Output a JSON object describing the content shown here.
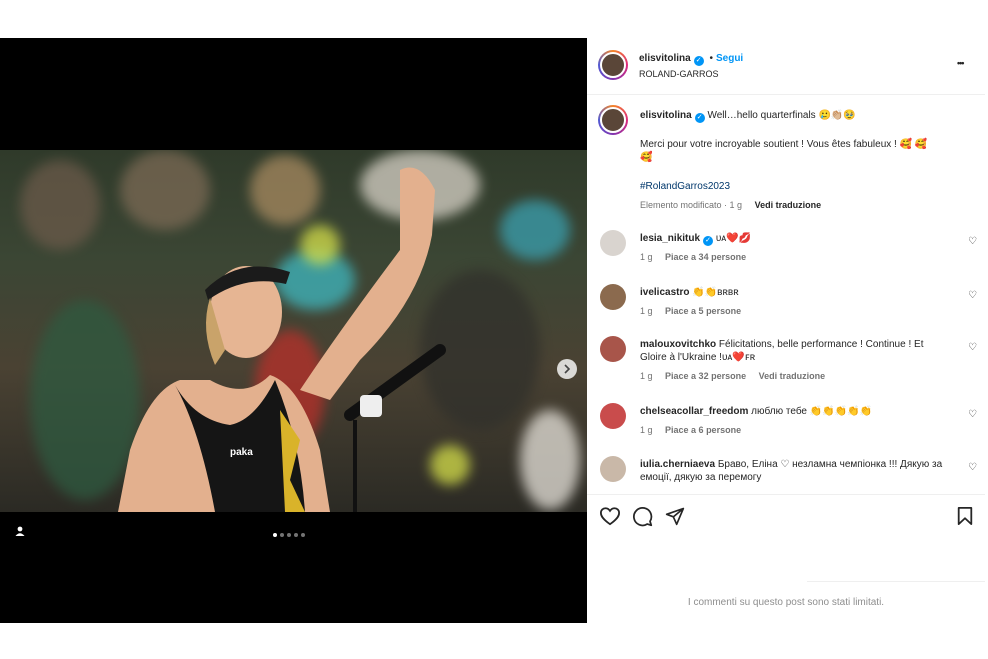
{
  "post": {
    "username": "elisvitolina",
    "follow_label": "Segui",
    "dot_separator": "•",
    "location": "ROLAND-GARROS",
    "more_label": "•••",
    "caption_line1": "Well…hello quarterfinals 🥲👏🏼🥹",
    "caption_line2": "Merci pour votre incroyable soutient ! Vous êtes fabuleux ! 🥰 🥰",
    "caption_line3": "🥰",
    "hashtag": "#RolandGarros2023",
    "edited_label": "Elemento modificato · 1 g",
    "see_translation": "Vedi traduzione"
  },
  "media": {
    "slides": 5,
    "active_slide": 1
  },
  "comments": [
    {
      "username": "lesia_nikituk",
      "verified": true,
      "text": "ᴜᴀ❤️💋",
      "time": "1 g",
      "likes": "Piace a 34 persone",
      "translation": "",
      "avatar_color": "#d9d4cf"
    },
    {
      "username": "ivelicastro",
      "verified": false,
      "text": "👏👏ʙʀʙʀ",
      "time": "1 g",
      "likes": "Piace a 5 persone",
      "translation": "",
      "avatar_color": "#8b6a4e"
    },
    {
      "username": "malouxovitchko",
      "verified": false,
      "text": "Félicitations, belle performance ! Continue ! Et Gloire à l'Ukraine !ᴜᴀ❤️ꜰʀ",
      "time": "1 g",
      "likes": "Piace a 32 persone",
      "translation": "Vedi traduzione",
      "avatar_color": "#a8554a"
    },
    {
      "username": "chelseacollar_freedom",
      "verified": false,
      "text": "люблю тебе 👏👏👏👏👏",
      "time": "1 g",
      "likes": "Piace a 6 persone",
      "translation": "",
      "avatar_color": "#c94c4c"
    },
    {
      "username": "iulia.cherniaeva",
      "verified": false,
      "text": "Браво, Еліна ♡ незламна чемпіонка !!! Дякую за емоції, дякую за перемогу",
      "time": "",
      "likes": "",
      "translation": "",
      "avatar_color": "#c9b8a8"
    }
  ],
  "actions": {
    "like": "heart-icon",
    "comment": "comment-icon",
    "share": "share-icon",
    "save": "bookmark-icon"
  },
  "footer": {
    "limited_text": "I commenti su questo post sono stati limitati."
  },
  "colors": {
    "accent": "#0095f6",
    "muted": "#737373",
    "border": "#efefef"
  }
}
